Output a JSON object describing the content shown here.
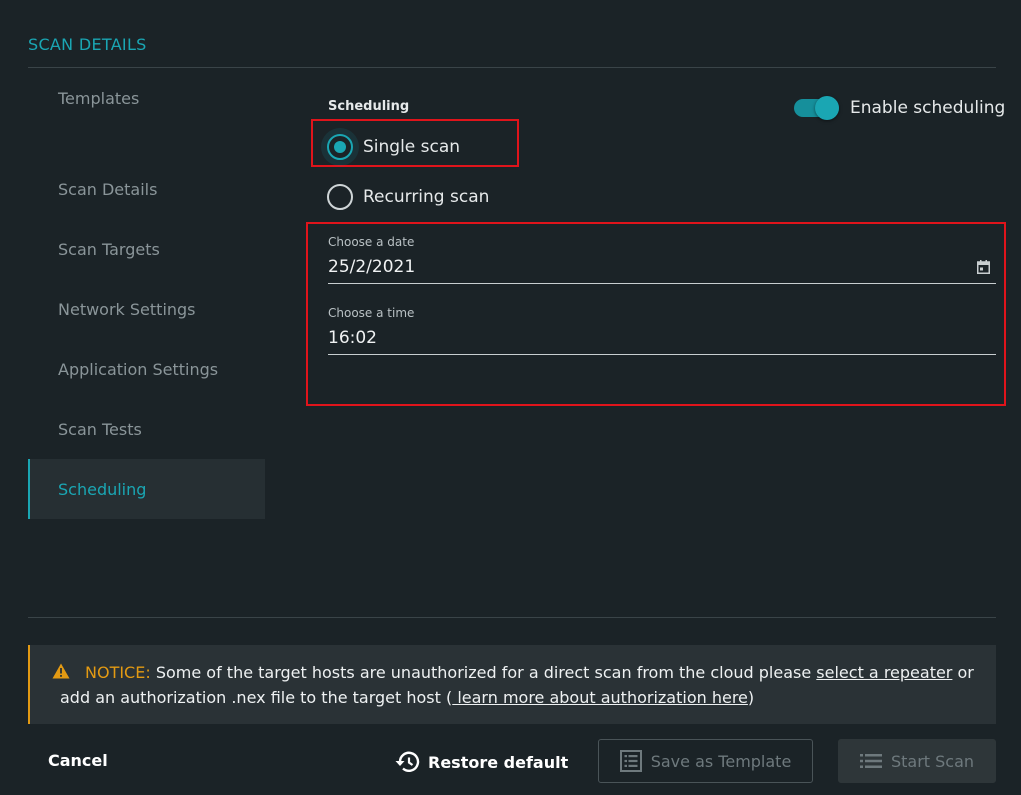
{
  "header": {
    "title": "SCAN DETAILS"
  },
  "sidebar": {
    "items": [
      {
        "label": "Templates"
      },
      {
        "label": "Scan Details"
      },
      {
        "label": "Scan Targets"
      },
      {
        "label": "Network Settings"
      },
      {
        "label": "Application Settings"
      },
      {
        "label": "Scan Tests"
      },
      {
        "label": "Scheduling"
      }
    ],
    "active": "Scheduling"
  },
  "scheduling": {
    "section_label": "Scheduling",
    "toggle_label": "Enable scheduling",
    "toggle_on": true,
    "options": [
      {
        "label": "Single scan",
        "selected": true
      },
      {
        "label": "Recurring scan",
        "selected": false
      }
    ],
    "date": {
      "label": "Choose a date",
      "value": "25/2/2021"
    },
    "time": {
      "label": "Choose a time",
      "value": "16:02"
    }
  },
  "notice": {
    "label": "NOTICE:",
    "text_1": " Some of the target hosts are unauthorized for a direct scan from the cloud please ",
    "link_1": "select a repeater",
    "text_2": " or",
    "text_3": "add an authorization .nex file to the target host (",
    "link_2": " learn more about authorization here",
    "text_4": ")"
  },
  "footer": {
    "cancel": "Cancel",
    "restore": "Restore default",
    "save_template": "Save as Template",
    "start_scan": "Start Scan"
  },
  "colors": {
    "accent": "#1aa6b3",
    "background": "#1b2327",
    "warning": "#e39a13",
    "highlight": "#e0141b"
  }
}
